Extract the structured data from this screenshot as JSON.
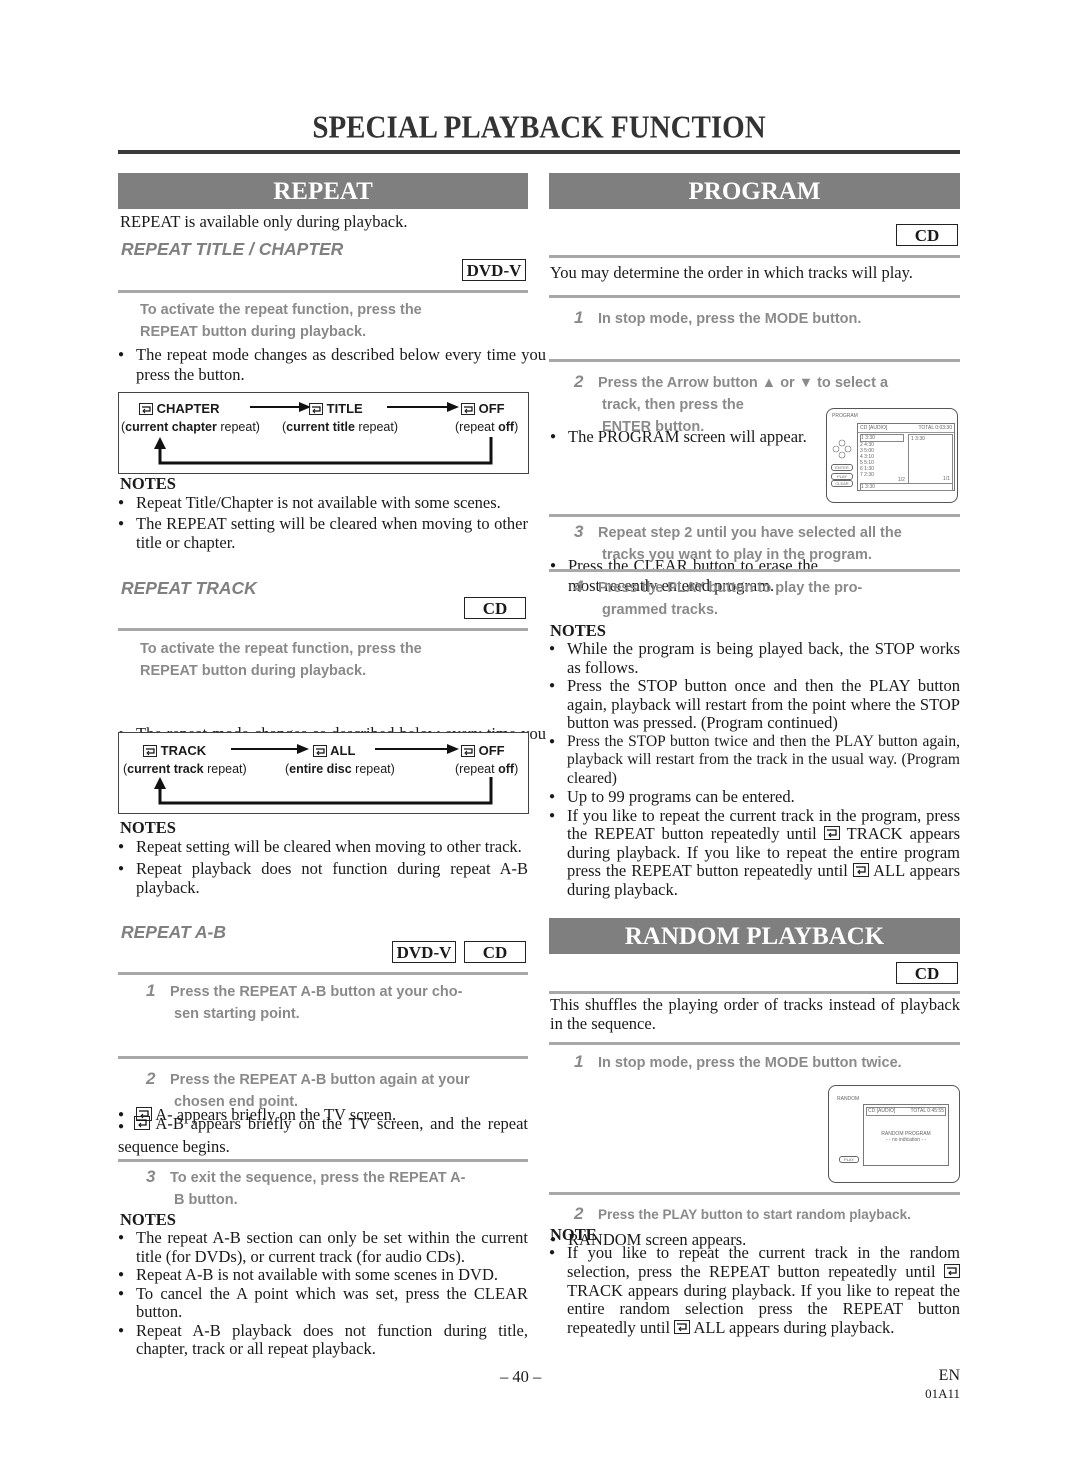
{
  "page": {
    "title": "SPECIAL PLAYBACK FUNCTION",
    "page_number": "– 40 –",
    "lang_code": "EN",
    "doc_code": "01A11"
  },
  "repeat": {
    "banner": "REPEAT",
    "intro": "REPEAT is available only during playback.",
    "title_chapter": {
      "heading": "REPEAT TITLE / CHAPTER",
      "badge": "DVD-V",
      "instruction_line1": "To activate the repeat function, press the",
      "instruction_line2": "REPEAT button during playback.",
      "bullet": "The repeat mode changes as described below every time you press the button.",
      "diagram": {
        "modes": [
          {
            "label": "CHAPTER",
            "sub_bold": "current chapter",
            "sub_rest": " repeat",
            "sub_prefix": "("
          },
          {
            "label": "TITLE",
            "sub_bold": "current title",
            "sub_rest": " repeat",
            "sub_prefix": "("
          },
          {
            "label": "OFF",
            "sub_bold": "off",
            "sub_rest": "",
            "sub_prefix": "(repeat "
          }
        ]
      },
      "notes_heading": "NOTES",
      "notes": [
        "Repeat Title/Chapter is not available with some scenes.",
        "The REPEAT setting will be cleared when moving to other title or chapter."
      ]
    },
    "track": {
      "heading": "REPEAT TRACK",
      "badge": "CD",
      "instruction_line1": "To activate the repeat function, press the",
      "instruction_line2": "REPEAT button during playback.",
      "bullet": "The repeat mode changes as described below every time you press the button.",
      "diagram": {
        "modes": [
          {
            "label": "TRACK",
            "sub_bold": "current track",
            "sub_rest": " repeat",
            "sub_prefix": "("
          },
          {
            "label": "ALL",
            "sub_bold": "entire disc",
            "sub_rest": " repeat",
            "sub_prefix": "("
          },
          {
            "label": "OFF",
            "sub_bold": "off",
            "sub_rest": "",
            "sub_prefix": "(repeat "
          }
        ]
      },
      "notes_heading": "NOTES",
      "notes": [
        "Repeat setting will be cleared when moving to other track.",
        "Repeat playback does not function during repeat A-B playback."
      ]
    },
    "ab": {
      "heading": "REPEAT A-B",
      "badge_dvd": "DVD-V",
      "badge_cd": "CD",
      "steps": [
        {
          "num": "1",
          "line1": "Press the REPEAT A-B button at your cho-",
          "line2": "sen starting point.",
          "result": "A- appears briefly on the TV screen."
        },
        {
          "num": "2",
          "line1": "Press the REPEAT A-B button again at your",
          "line2": "chosen end point.",
          "result": "A-B appears briefly on the TV screen, and the repeat sequence begins."
        },
        {
          "num": "3",
          "line1": "To exit the sequence, press the REPEAT A-",
          "line2": "B button.",
          "result": ""
        }
      ],
      "notes_heading": "NOTES",
      "notes": [
        "The repeat A-B section can only be set within the current title (for DVDs), or current track (for audio CDs).",
        "Repeat A-B is not available with some scenes in DVD.",
        "To cancel the A point which was set, press the CLEAR button.",
        "Repeat A-B playback does not function during title, chapter, track or all repeat playback."
      ]
    }
  },
  "program": {
    "banner": "PROGRAM",
    "badge": "CD",
    "intro": "You may determine the order in which tracks will play.",
    "steps": [
      {
        "num": "1",
        "line1": "In stop mode, press the MODE button.",
        "result": "The PROGRAM screen will appear."
      },
      {
        "num": "2",
        "line1": "Press the Arrow button ▲ or ▼ to select a",
        "line2": "track, then press the",
        "line3": "ENTER button.",
        "result": "Press the CLEAR button to erase the most recently entered program."
      },
      {
        "num": "3",
        "line1": "Repeat step 2 until you have selected all the",
        "line2": "tracks you want to play in the program."
      },
      {
        "num": "4",
        "line1": "Press the PLAY button to play the pro-",
        "line2": "grammed tracks."
      }
    ],
    "screen": {
      "title": "PROGRAM",
      "source": "CD [AUDIO]",
      "total": "TOTAL 0:03:30",
      "tracks": [
        "1  3:30",
        "2  4:30",
        "3  5:00",
        "4  3:10",
        "5  5:10",
        "6  1:30",
        "7  2:30"
      ],
      "page_left": "1/2",
      "program_list": [
        "1  3:30"
      ],
      "page_right": "1/1",
      "current": "1  3:30",
      "buttons": [
        "ENTER",
        "PLAY",
        "CLEAR"
      ]
    },
    "notes_heading": "NOTES",
    "notes": [
      "While the program is being played back, the STOP works as follows.",
      "Press the STOP button once and then the PLAY button again, playback will restart from the point where the STOP button was pressed. (Program continued)",
      "Press the STOP button twice and then the PLAY button again, playback will restart from the track in the usual way. (Program cleared)",
      "Up to 99 programs can be entered."
    ],
    "repeat_note_parts": [
      "If you like to repeat the current track in the program, press the REPEAT button repeatedly until",
      "TRACK appears during playback. If you like to repeat the entire program press the REPEAT button repeatedly until",
      "ALL appears during playback."
    ]
  },
  "random": {
    "banner": "RANDOM PLAYBACK",
    "badge": "CD",
    "intro": "This shuffles the playing order of tracks instead of playback in the sequence.",
    "steps": [
      {
        "num": "1",
        "line1": "In stop mode, press the MODE button twice.",
        "result": "RANDOM screen appears."
      },
      {
        "num": "2",
        "line1": "Press the PLAY button to start random playback."
      }
    ],
    "screen": {
      "title": "RANDOM",
      "source": "CD [AUDIO]",
      "total": "TOTAL 0:45:55",
      "center_line1": "RANDOM PROGRAM",
      "center_line2": "- - no indication - -",
      "button": "PLAY"
    },
    "note_heading": "NOTE",
    "note_parts": [
      "If you like to repeat the current track in the random selection, press the REPEAT button repeatedly until",
      "TRACK appears during playback. If you like to repeat the entire random selection press the REPEAT button repeatedly until",
      "ALL appears during playback."
    ]
  }
}
